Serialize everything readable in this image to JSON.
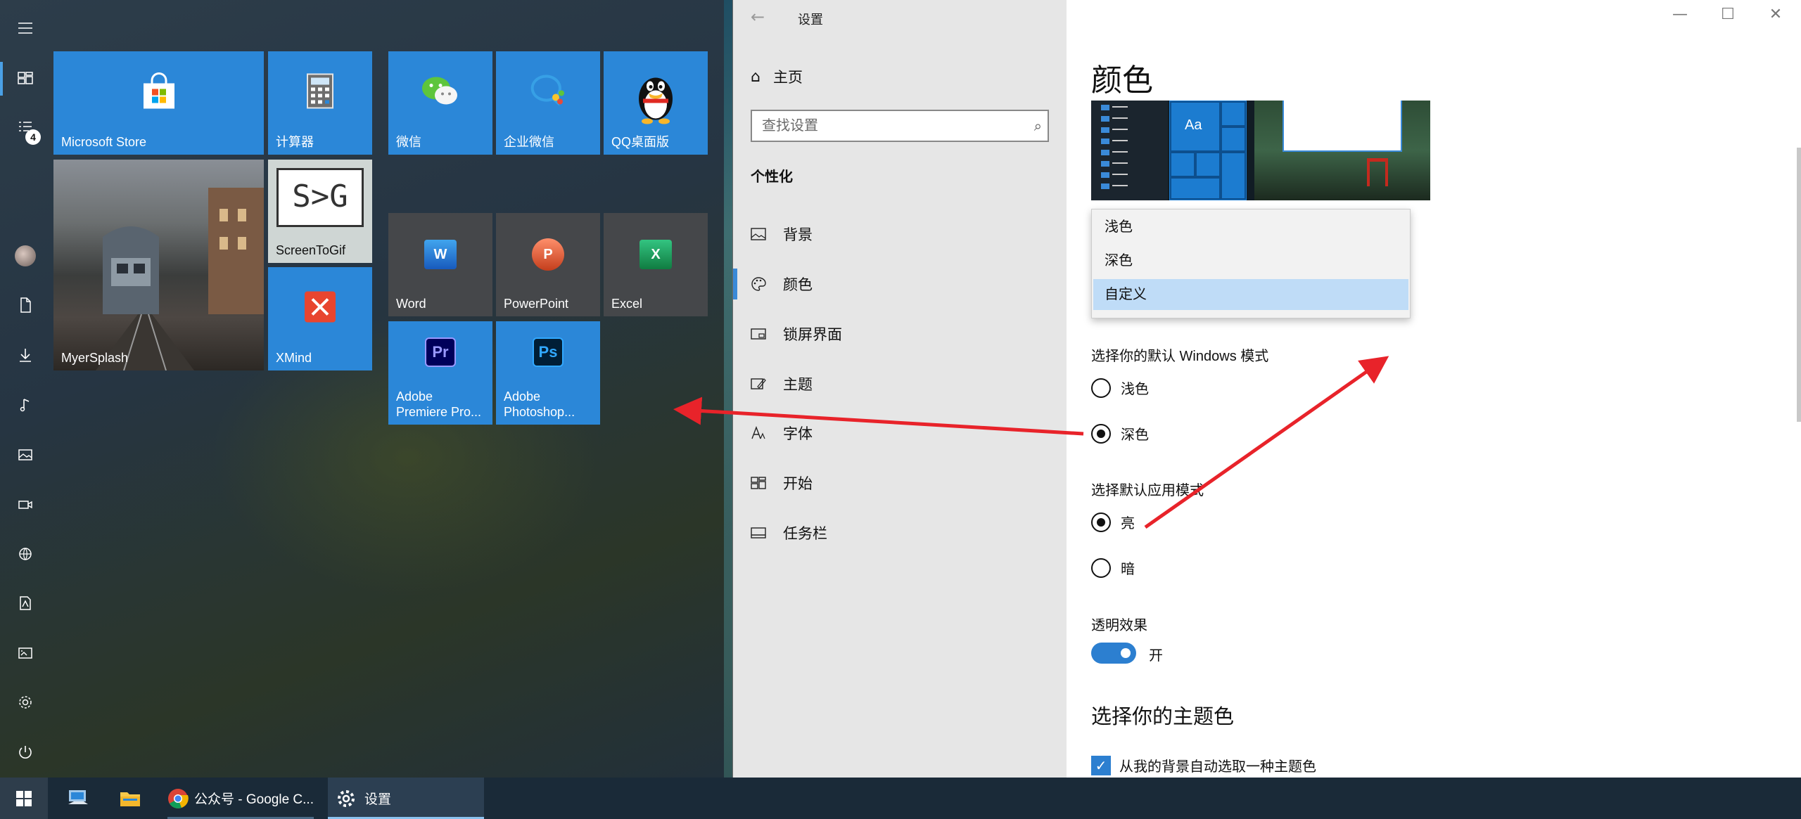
{
  "start_menu": {
    "rail": {
      "menu_icon": "hamburger-icon",
      "badge_count": "4"
    },
    "tiles": [
      {
        "label": "Microsoft Store",
        "icon": "store-icon"
      },
      {
        "label": "计算器",
        "icon": "calculator-icon"
      },
      {
        "label": "微信",
        "icon": "wechat-icon"
      },
      {
        "label": "企业微信",
        "icon": "wecom-icon"
      },
      {
        "label": "QQ桌面版",
        "icon": "qq-icon"
      },
      {
        "label": "MyerSplash",
        "icon": "photo-tile"
      },
      {
        "label": "ScreenToGif",
        "icon": "screentogif-icon",
        "logo_text": "S>G"
      },
      {
        "label": "XMind",
        "icon": "xmind-icon"
      },
      {
        "label": "Word",
        "icon": "word-icon",
        "logo_text": "W"
      },
      {
        "label": "PowerPoint",
        "icon": "powerpoint-icon",
        "logo_text": "P"
      },
      {
        "label": "Excel",
        "icon": "excel-icon",
        "logo_text": "X"
      },
      {
        "label": "Adobe Premiere Pro...",
        "icon": "premiere-icon",
        "logo_text": "Pr"
      },
      {
        "label": "Adobe Photoshop...",
        "icon": "photoshop-icon",
        "logo_text": "Ps"
      }
    ]
  },
  "settings": {
    "window_title": "设置",
    "home_label": "主页",
    "search_placeholder": "查找设置",
    "section_title": "个性化",
    "nav_items": [
      {
        "label": "背景",
        "icon": "picture-icon"
      },
      {
        "label": "颜色",
        "icon": "palette-icon",
        "selected": true
      },
      {
        "label": "锁屏界面",
        "icon": "lockscreen-icon"
      },
      {
        "label": "主题",
        "icon": "theme-icon"
      },
      {
        "label": "字体",
        "icon": "font-icon"
      },
      {
        "label": "开始",
        "icon": "start-icon"
      },
      {
        "label": "任务栏",
        "icon": "taskbar-icon"
      }
    ],
    "page_title": "颜色",
    "dropdown_options": [
      "浅色",
      "深色",
      "自定义"
    ],
    "dropdown_selected": "自定义",
    "windows_mode": {
      "label": "选择你的默认 Windows 模式",
      "options": [
        "浅色",
        "深色"
      ],
      "selected": "深色"
    },
    "app_mode": {
      "label": "选择默认应用模式",
      "options": [
        "亮",
        "暗"
      ],
      "selected": "亮"
    },
    "transparency": {
      "label": "透明效果",
      "state_label": "开",
      "on": true
    },
    "accent_title": "选择你的主题色",
    "auto_accent": {
      "label": "从我的背景自动选取一种主题色",
      "checked": true
    },
    "preview_tile_text": "Aa"
  },
  "taskbar": {
    "items": [
      {
        "label": "",
        "icon": "windows-start-icon"
      },
      {
        "label": "",
        "icon": "desktop-app-icon"
      },
      {
        "label": "",
        "icon": "file-explorer-icon"
      },
      {
        "label": "公众号 - Google C...",
        "icon": "chrome-icon"
      },
      {
        "label": "设置",
        "icon": "settings-gear-icon"
      }
    ]
  },
  "colors": {
    "accent": "#2b87d8",
    "annotation_arrow": "#e8232a"
  }
}
